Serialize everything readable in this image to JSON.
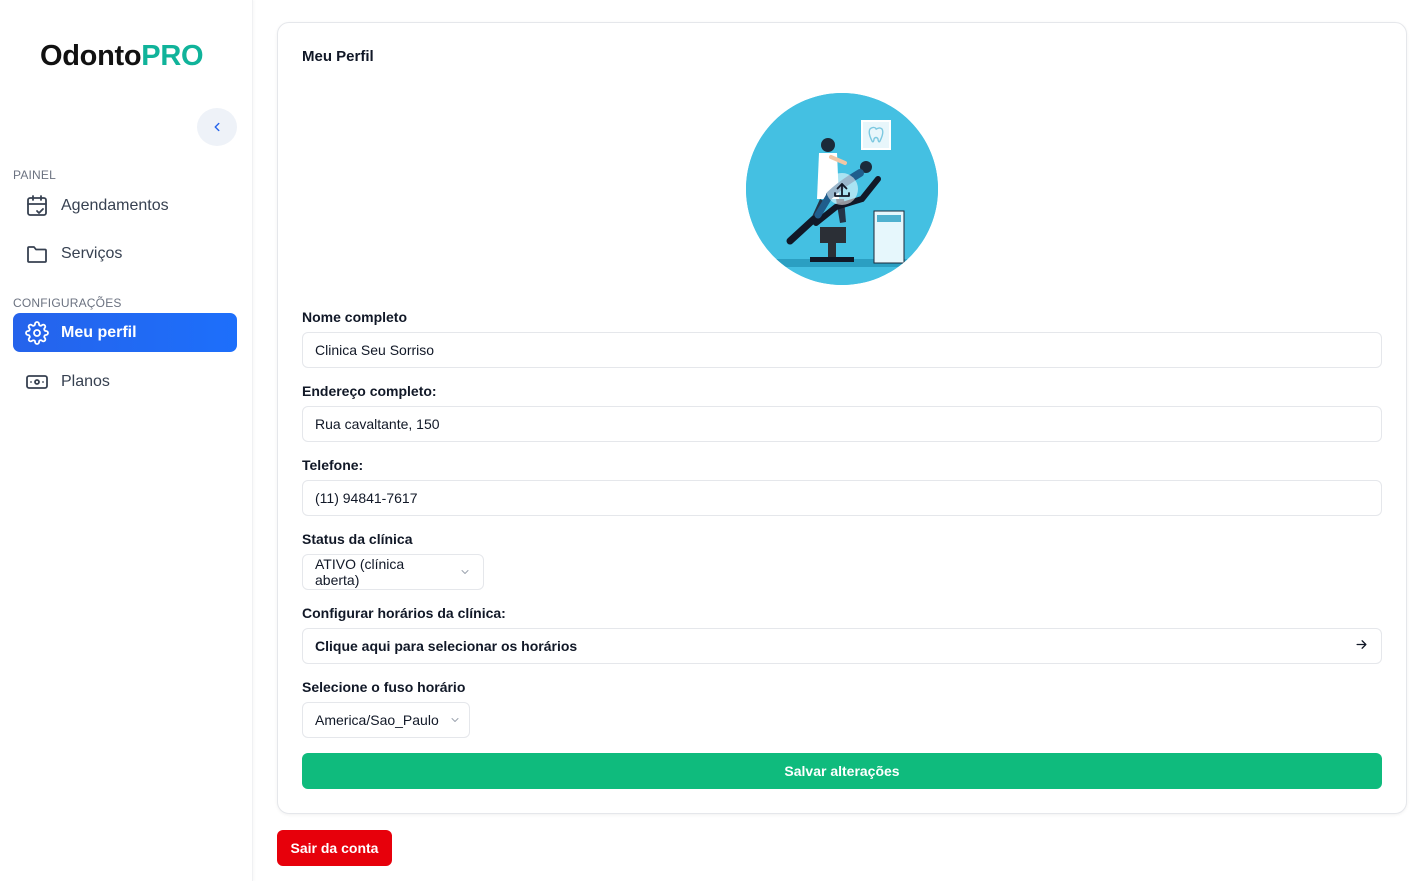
{
  "brand": {
    "part1": "Odonto",
    "part2": "PRO",
    "color_dark": "#111111",
    "color_accent": "#10b39a"
  },
  "sidebar": {
    "collapse_icon": "chevron-left-icon",
    "sections": [
      {
        "label": "PAINEL"
      },
      {
        "label": "CONFIGURAÇÕES"
      }
    ],
    "items": [
      {
        "label": "Agendamentos",
        "icon": "calendar-check-icon",
        "active": false
      },
      {
        "label": "Serviços",
        "icon": "folder-icon",
        "active": false
      },
      {
        "label": "Meu perfil",
        "icon": "gear-icon",
        "active": true
      },
      {
        "label": "Planos",
        "icon": "banknote-icon",
        "active": false
      }
    ],
    "active_color": "#2563eb"
  },
  "profile": {
    "title": "Meu Perfil",
    "avatar_icon": "upload-icon",
    "name_label": "Nome completo",
    "name_value": "Clinica Seu Sorriso",
    "address_label": "Endereço completo:",
    "address_value": "Rua cavaltante, 150",
    "phone_label": "Telefone:",
    "phone_value": "(11) 94841-7617",
    "status_label": "Status da clínica",
    "status_value": "ATIVO (clínica aberta)",
    "hours_label": "Configurar horários da clínica:",
    "hours_button": "Clique aqui para selecionar os horários",
    "timezone_label": "Selecione o fuso horário",
    "timezone_value": "America/Sao_Paulo",
    "save_label": "Salvar alterações",
    "save_color": "#0fbb7d"
  },
  "logout": {
    "label": "Sair da conta",
    "color": "#e7000b"
  }
}
